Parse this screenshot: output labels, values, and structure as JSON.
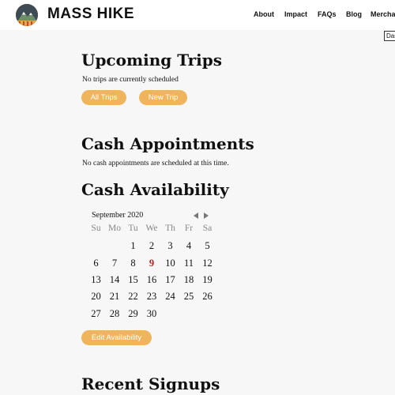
{
  "header": {
    "brand": "MASS HIKE",
    "nav": [
      "About",
      "Impact",
      "FAQs",
      "Blog",
      "Mercha"
    ]
  },
  "dash_tab": "Das",
  "upcoming": {
    "title": "Upcoming Trips",
    "empty_text": "No trips are currently scheduled",
    "all_trips_label": "All Trips",
    "new_trip_label": "New Trip"
  },
  "cash_appointments": {
    "title": "Cash Appointments",
    "empty_text": "No cash appointments are scheduled at this time."
  },
  "cash_availability": {
    "title": "Cash Availability",
    "month_label": "September 2020",
    "weekdays": [
      "Su",
      "Mo",
      "Tu",
      "We",
      "Th",
      "Fr",
      "Sa"
    ],
    "days": [
      [
        "",
        "",
        "1",
        "2",
        "3",
        "4",
        "5"
      ],
      [
        "6",
        "7",
        "8",
        "9",
        "10",
        "11",
        "12"
      ],
      [
        "13",
        "14",
        "15",
        "16",
        "17",
        "18",
        "19"
      ],
      [
        "20",
        "21",
        "22",
        "23",
        "24",
        "25",
        "26"
      ],
      [
        "27",
        "28",
        "29",
        "30",
        "",
        "",
        ""
      ]
    ],
    "today": "9",
    "edit_label": "Edit Availability"
  },
  "recent_signups": {
    "title": "Recent Signups"
  },
  "colors": {
    "accent": "#f0b55c",
    "today": "#b22222"
  }
}
